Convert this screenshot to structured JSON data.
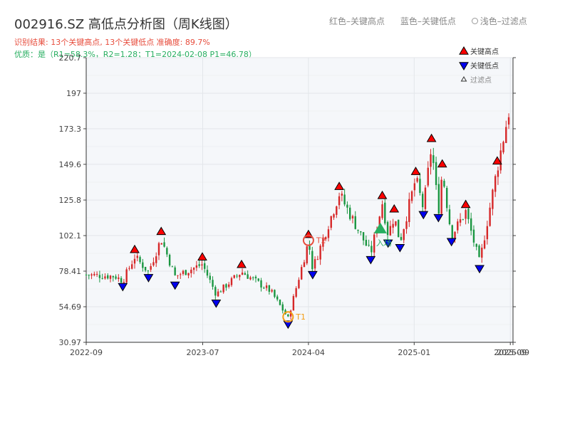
{
  "header": {
    "title": "002916.SZ 高低点分析图（周K线图）",
    "result_line": "识别结果: 13个关键高点, 13个关键低点   准确度: 89.7%",
    "quality_line": "优质：是（R1=58.3%，R2=1.28；T1=2024-02-08 P1=46.78）"
  },
  "top_legend": {
    "red": "红色–关键高点",
    "blue": "蓝色–关键低点",
    "light": "浅色–过滤点"
  },
  "colors": {
    "up": "#d62728",
    "down": "#1a9641",
    "high_marker": "#ff0000",
    "low_marker": "#0000ee",
    "t1": "#f39c12",
    "t2": "#e74c3c",
    "entry": "#27ae60",
    "plot_bg": "#f5f7fa"
  },
  "chart_data": {
    "type": "candlestick",
    "ylim": [
      30.97,
      220.7
    ],
    "yticks": [
      30.97,
      54.69,
      78.41,
      102.1,
      125.8,
      149.6,
      173.3,
      197.0,
      220.7
    ],
    "xlim": [
      "2022-09-01",
      "2025-09-15"
    ],
    "xticks": [
      {
        "label": "2022-09",
        "date": "2022-09-01"
      },
      {
        "label": "2023-07",
        "date": "2023-07-01"
      },
      {
        "label": "2024-04",
        "date": "2024-04-01"
      },
      {
        "label": "2025-01",
        "date": "2025-01-01"
      },
      {
        "label": "2025-09",
        "date": "2025-09-08"
      },
      {
        "label": "2025-09",
        "date": "2025-09-15"
      }
    ],
    "grid": true,
    "legend_position": "top-right",
    "legend": {
      "high": "关键高点",
      "low": "关键低点",
      "filtered": "过滤点"
    },
    "anchors": [
      {
        "date": "2022-09-01",
        "price": 76
      },
      {
        "date": "2022-11-15",
        "price": 75
      },
      {
        "date": "2022-12-05",
        "price": 72
      },
      {
        "date": "2023-01-05",
        "price": 88
      },
      {
        "date": "2023-02-10",
        "price": 78
      },
      {
        "date": "2023-03-15",
        "price": 100
      },
      {
        "date": "2023-04-20",
        "price": 75
      },
      {
        "date": "2023-06-30",
        "price": 83
      },
      {
        "date": "2023-08-05",
        "price": 63
      },
      {
        "date": "2023-10-10",
        "price": 78
      },
      {
        "date": "2023-12-25",
        "price": 65
      },
      {
        "date": "2024-02-08",
        "price": 47
      },
      {
        "date": "2024-04-01",
        "price": 98
      },
      {
        "date": "2024-04-12",
        "price": 80
      },
      {
        "date": "2024-06-20",
        "price": 130
      },
      {
        "date": "2024-09-10",
        "price": 90
      },
      {
        "date": "2024-10-10",
        "price": 124
      },
      {
        "date": "2024-10-25",
        "price": 103
      },
      {
        "date": "2024-11-10",
        "price": 115
      },
      {
        "date": "2024-11-25",
        "price": 98
      },
      {
        "date": "2025-01-05",
        "price": 140
      },
      {
        "date": "2025-01-25",
        "price": 120
      },
      {
        "date": "2025-02-15",
        "price": 162
      },
      {
        "date": "2025-03-05",
        "price": 118
      },
      {
        "date": "2025-03-15",
        "price": 145
      },
      {
        "date": "2025-04-08",
        "price": 102
      },
      {
        "date": "2025-05-15",
        "price": 118
      },
      {
        "date": "2025-06-20",
        "price": 84
      },
      {
        "date": "2025-08-05",
        "price": 147
      },
      {
        "date": "2025-09-10",
        "price": 192
      }
    ],
    "key_highs": [
      {
        "date": "2023-01-05",
        "price": 88
      },
      {
        "date": "2023-03-15",
        "price": 100
      },
      {
        "date": "2023-06-30",
        "price": 83
      },
      {
        "date": "2023-10-10",
        "price": 78
      },
      {
        "date": "2024-04-01",
        "price": 98
      },
      {
        "date": "2024-06-20",
        "price": 130
      },
      {
        "date": "2024-10-10",
        "price": 124
      },
      {
        "date": "2024-11-10",
        "price": 115
      },
      {
        "date": "2025-01-05",
        "price": 140
      },
      {
        "date": "2025-02-15",
        "price": 162
      },
      {
        "date": "2025-03-15",
        "price": 145
      },
      {
        "date": "2025-05-15",
        "price": 118
      },
      {
        "date": "2025-08-05",
        "price": 147
      }
    ],
    "key_lows": [
      {
        "date": "2022-12-05",
        "price": 72
      },
      {
        "date": "2023-02-10",
        "price": 78
      },
      {
        "date": "2023-04-20",
        "price": 73
      },
      {
        "date": "2023-08-05",
        "price": 61
      },
      {
        "date": "2024-02-08",
        "price": 47
      },
      {
        "date": "2024-04-12",
        "price": 80
      },
      {
        "date": "2024-09-10",
        "price": 90
      },
      {
        "date": "2024-10-25",
        "price": 101
      },
      {
        "date": "2024-11-25",
        "price": 98
      },
      {
        "date": "2025-01-25",
        "price": 120
      },
      {
        "date": "2025-03-05",
        "price": 118
      },
      {
        "date": "2025-04-08",
        "price": 102
      },
      {
        "date": "2025-06-20",
        "price": 84
      }
    ],
    "t1": {
      "label": "T1",
      "date": "2024-02-08",
      "price": 47
    },
    "t2": {
      "label": "T2",
      "date": "2024-04-01",
      "price": 98
    },
    "entry": {
      "label": "入场",
      "date": "2024-10-05",
      "price": 106
    }
  }
}
